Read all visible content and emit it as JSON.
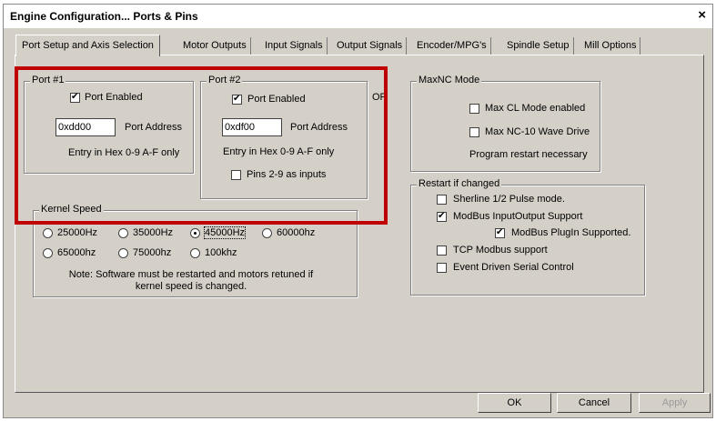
{
  "window": {
    "title": "Engine Configuration... Ports & Pins",
    "close_label": "×"
  },
  "tabs": [
    "Port Setup and Axis Selection",
    "Motor Outputs",
    "Input Signals",
    "Output Signals",
    "Encoder/MPG's",
    "Spindle Setup",
    "Mill Options"
  ],
  "port1": {
    "title": "Port #1",
    "enabled_label": "Port Enabled",
    "enabled": true,
    "address_value": "0xdd00",
    "address_label": "Port Address",
    "hint": "Entry in Hex 0-9 A-F only"
  },
  "port2": {
    "title": "Port #2",
    "enabled_label": "Port Enabled",
    "enabled": true,
    "address_value": "0xdf00",
    "address_label": "Port Address",
    "hint": "Entry in Hex 0-9 A-F only",
    "pins_label": "Pins 2-9 as inputs",
    "pins_checked": false
  },
  "or_label": "OR",
  "maxnc": {
    "title": "MaxNC Mode",
    "max_cl_label": "Max CL Mode enabled",
    "max_nc10_label": "Max NC-10 Wave Drive",
    "restart_note": "Program restart necessary"
  },
  "restart": {
    "title": "Restart if changed",
    "sherline_label": "Sherline 1/2 Pulse mode.",
    "modbus_io_label": "ModBus InputOutput Support",
    "modbus_plugin_label": "ModBus PlugIn Supported.",
    "tcp_label": "TCP Modbus support",
    "event_label": "Event Driven Serial Control"
  },
  "kernel": {
    "title": "Kernel Speed",
    "options": [
      "25000Hz",
      "35000Hz",
      "45000Hz",
      "60000hz",
      "65000hz",
      "75000hz",
      "100khz"
    ],
    "selected": "45000Hz",
    "note_line1": "Note: Software must be restarted and motors retuned if",
    "note_line2": "kernel speed is changed."
  },
  "buttons": {
    "ok": "OK",
    "cancel": "Cancel",
    "apply": "Apply"
  },
  "colors": {
    "highlight": "#c00000",
    "dialog_bg": "#d4d0c8"
  }
}
